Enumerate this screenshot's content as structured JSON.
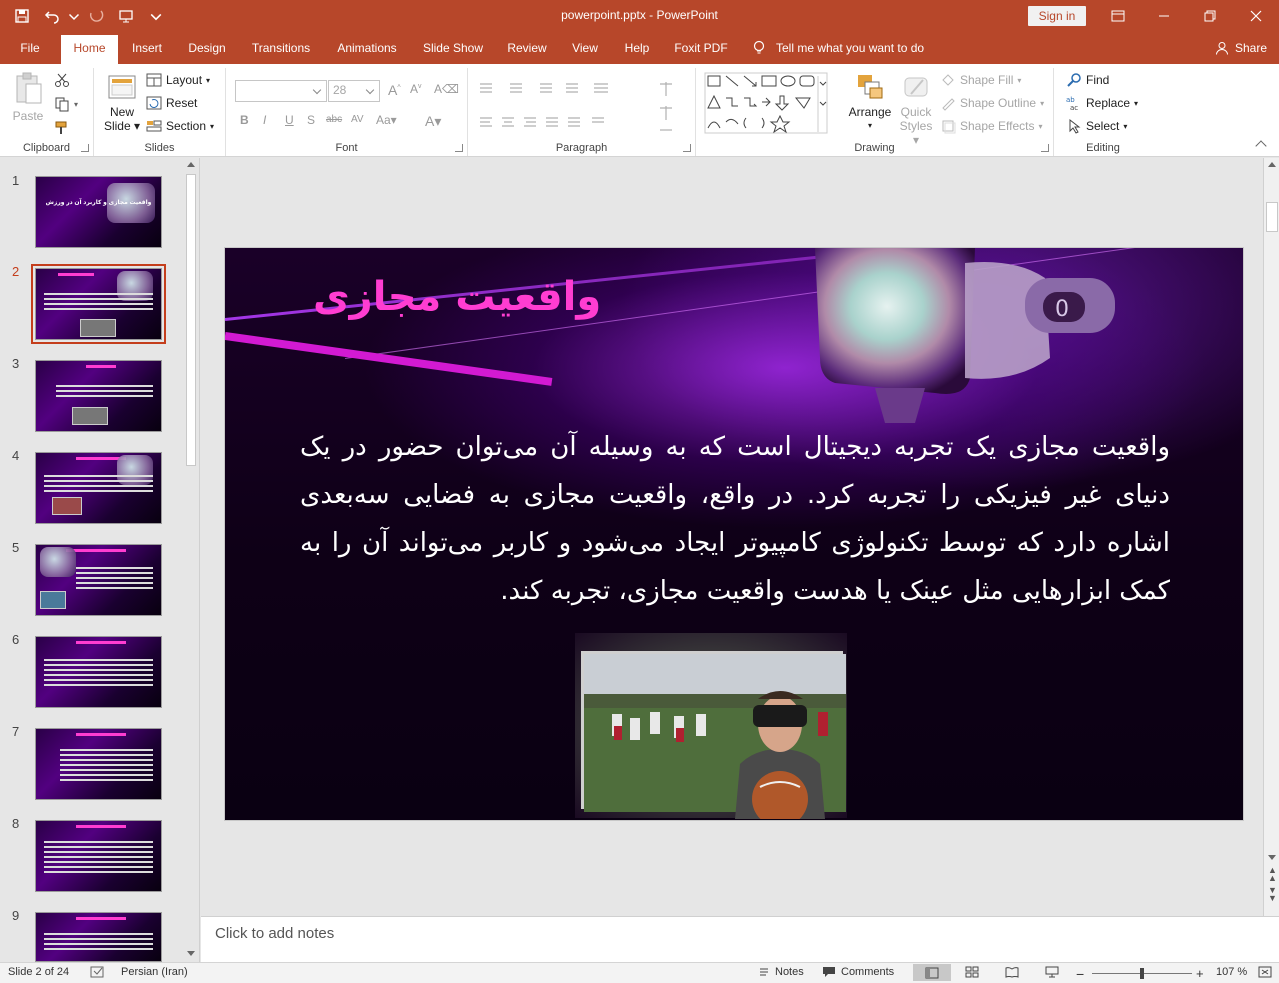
{
  "window": {
    "title": "powerpoint.pptx  -  PowerPoint",
    "sign_in": "Sign in"
  },
  "tabs": [
    "File",
    "Home",
    "Insert",
    "Design",
    "Transitions",
    "Animations",
    "Slide Show",
    "Review",
    "View",
    "Help",
    "Foxit PDF"
  ],
  "active_tab": "Home",
  "tell_me": "Tell me what you want to do",
  "share": "Share",
  "ribbon": {
    "clipboard": {
      "label": "Clipboard",
      "paste": "Paste"
    },
    "slides": {
      "label": "Slides",
      "new_slide_1": "New",
      "new_slide_2": "Slide",
      "layout": "Layout",
      "reset": "Reset",
      "section": "Section"
    },
    "font": {
      "label": "Font",
      "size": "28"
    },
    "paragraph": {
      "label": "Paragraph"
    },
    "drawing": {
      "label": "Drawing",
      "arrange": "Arrange",
      "quick_1": "Quick",
      "quick_2": "Styles",
      "shape_fill": "Shape Fill",
      "shape_outline": "Shape Outline",
      "shape_effects": "Shape Effects"
    },
    "editing": {
      "label": "Editing",
      "find": "Find",
      "replace": "Replace",
      "select": "Select"
    }
  },
  "thumbnails": [
    {
      "num": "1",
      "title": "واقعیت مجازی و کاربرد آن در ورزش"
    },
    {
      "num": "2"
    },
    {
      "num": "3"
    },
    {
      "num": "4"
    },
    {
      "num": "5"
    },
    {
      "num": "6"
    },
    {
      "num": "7"
    },
    {
      "num": "8"
    },
    {
      "num": "9"
    }
  ],
  "active_slide": 2,
  "slide": {
    "title": "واقعیت مجازی",
    "body": "واقعیت مجازی یک تجربه دیجیتال است که به وسیله آن می‌توان حضور در یک دنیای غیر فیزیکی را تجربه کرد. در واقع، واقعیت مجازی به فضایی سه‌بعدی اشاره دارد که توسط تکنولوژی کامپیوتر ایجاد می‌شود و کاربر می‌تواند آن را به کمک ابزارهایی مثل عینک یا هدست واقعیت مجازی، تجربه کند."
  },
  "notes_placeholder": "Click to add notes",
  "status": {
    "slide_info": "Slide 2 of 24",
    "language": "Persian (Iran)",
    "notes": "Notes",
    "comments": "Comments",
    "zoom": "107 %"
  },
  "colors": {
    "accent": "#b7472a",
    "title_pink": "#ff3dd1"
  }
}
